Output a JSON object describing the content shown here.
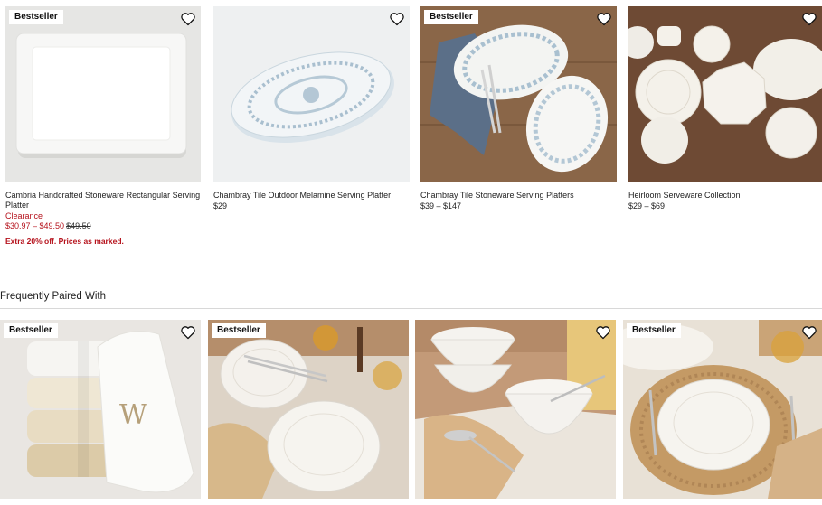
{
  "products": [
    {
      "badge": "Bestseller",
      "title": "Cambria Handcrafted Stoneware Rectangular Serving Platter",
      "status": "Clearance",
      "sale_range": "$30.97 – $49.50",
      "was_price": "$49.50",
      "promo": "Extra 20% off. Prices as marked."
    },
    {
      "title": "Chambray Tile Outdoor Melamine Serving Platter",
      "price": "$29"
    },
    {
      "badge": "Bestseller",
      "title": "Chambray Tile Stoneware Serving Platters",
      "price": "$39 – $147"
    },
    {
      "title": "Heirloom Serveware Collection",
      "price": "$29 – $69"
    }
  ],
  "paired": {
    "heading": "Frequently Paired With",
    "items": [
      {
        "badge": "Bestseller",
        "monogram": "W"
      },
      {
        "badge": "Bestseller"
      },
      {},
      {
        "badge": "Bestseller"
      }
    ]
  },
  "icons": {
    "favorite": "heart-outline-icon"
  },
  "colors": {
    "sale_red": "#b5111b",
    "text": "#222222"
  }
}
